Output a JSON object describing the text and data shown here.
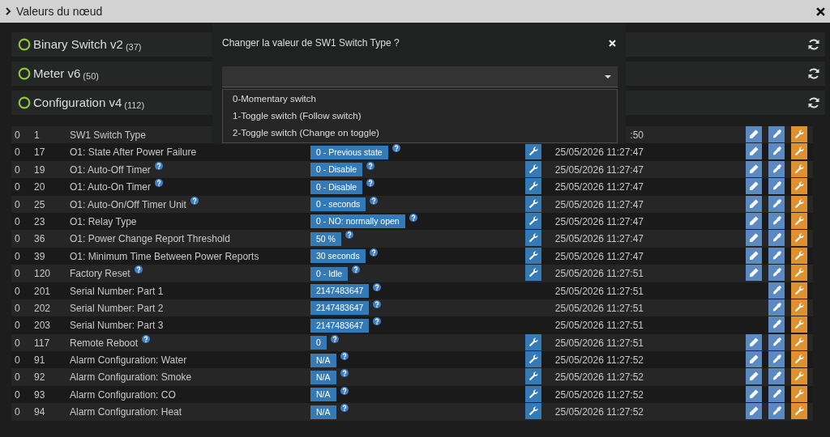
{
  "window": {
    "title": "Valeurs du nœud"
  },
  "sections": [
    {
      "name": "Binary Switch v2",
      "count": "(37)"
    },
    {
      "name": "Meter v6",
      "count": "(50)"
    },
    {
      "name": "Configuration v4",
      "count": "(112)"
    }
  ],
  "rows": [
    {
      "instance": "0",
      "index": "1",
      "label": "SW1 Switch Type",
      "help": false,
      "date": ":50",
      "edit": true
    },
    {
      "instance": "0",
      "index": "17",
      "label": "O1: State After Power Failure",
      "help": false,
      "value": "0 - Previous state",
      "value_help": true,
      "wrench": true,
      "date": "25/05/2026 11:27:47",
      "edit": true
    },
    {
      "instance": "0",
      "index": "19",
      "label": "O1: Auto-Off Timer",
      "help": true,
      "value": "0 - Disable",
      "value_help": true,
      "wrench": true,
      "date": "25/05/2026 11:27:47",
      "edit": true
    },
    {
      "instance": "0",
      "index": "20",
      "label": "O1: Auto-On Timer",
      "help": true,
      "value": "0 - Disable",
      "value_help": true,
      "wrench": true,
      "date": "25/05/2026 11:27:47",
      "edit": true
    },
    {
      "instance": "0",
      "index": "25",
      "label": "O1: Auto-On/Off Timer Unit",
      "help": true,
      "value": "0 - seconds",
      "value_help": true,
      "wrench": true,
      "date": "25/05/2026 11:27:47",
      "edit": true
    },
    {
      "instance": "0",
      "index": "23",
      "label": "O1: Relay Type",
      "help": false,
      "value": "0 - NO: normally open",
      "value_help": true,
      "wrench": true,
      "date": "25/05/2026 11:27:47",
      "edit": true
    },
    {
      "instance": "0",
      "index": "36",
      "label": "O1: Power Change Report Threshold",
      "help": false,
      "value": "50 %",
      "value_help": true,
      "wrench": true,
      "date": "25/05/2026 11:27:47",
      "edit": true
    },
    {
      "instance": "0",
      "index": "39",
      "label": "O1: Minimum Time Between Power Reports",
      "help": false,
      "value": "30 seconds",
      "value_help": true,
      "wrench": true,
      "date": "25/05/2026 11:27:47",
      "edit": true
    },
    {
      "instance": "0",
      "index": "120",
      "label": "Factory Reset",
      "help": true,
      "value": "0 - Idle",
      "value_help": true,
      "wrench": true,
      "date": "25/05/2026 11:27:51",
      "edit": true
    },
    {
      "instance": "0",
      "index": "201",
      "label": "Serial Number: Part 1",
      "help": false,
      "value": "2147483647",
      "value_help": true,
      "wrench": false,
      "date": "25/05/2026 11:27:51",
      "edit": false
    },
    {
      "instance": "0",
      "index": "202",
      "label": "Serial Number: Part 2",
      "help": false,
      "value": "2147483647",
      "value_help": true,
      "wrench": false,
      "date": "25/05/2026 11:27:51",
      "edit": false
    },
    {
      "instance": "0",
      "index": "203",
      "label": "Serial Number: Part 3",
      "help": false,
      "value": "2147483647",
      "value_help": true,
      "wrench": false,
      "date": "25/05/2026 11:27:51",
      "edit": false
    },
    {
      "instance": "0",
      "index": "117",
      "label": "Remote Reboot",
      "help": true,
      "value": "0",
      "value_help": true,
      "wrench": true,
      "date": "25/05/2026 11:27:51",
      "edit": true
    },
    {
      "instance": "0",
      "index": "91",
      "label": "Alarm Configuration: Water",
      "help": false,
      "value": "N/A",
      "value_help": true,
      "wrench": true,
      "date": "25/05/2026 11:27:52",
      "edit": true
    },
    {
      "instance": "0",
      "index": "92",
      "label": "Alarm Configuration: Smoke",
      "help": false,
      "value": "N/A",
      "value_help": true,
      "wrench": true,
      "date": "25/05/2026 11:27:52",
      "edit": true
    },
    {
      "instance": "0",
      "index": "93",
      "label": "Alarm Configuration: CO",
      "help": false,
      "value": "N/A",
      "value_help": true,
      "wrench": true,
      "date": "25/05/2026 11:27:52",
      "edit": true
    },
    {
      "instance": "0",
      "index": "94",
      "label": "Alarm Configuration: Heat",
      "help": false,
      "value": "N/A",
      "value_help": true,
      "wrench": true,
      "date": "25/05/2026 11:27:52",
      "edit": true
    }
  ],
  "dialog": {
    "title": "Changer la valeur de SW1 Switch Type ?",
    "select": {
      "expanded": true,
      "options": [
        "0-Momentary switch",
        "1-Toggle switch (Follow switch)",
        "2-Toggle switch (Change on toggle)"
      ]
    }
  }
}
